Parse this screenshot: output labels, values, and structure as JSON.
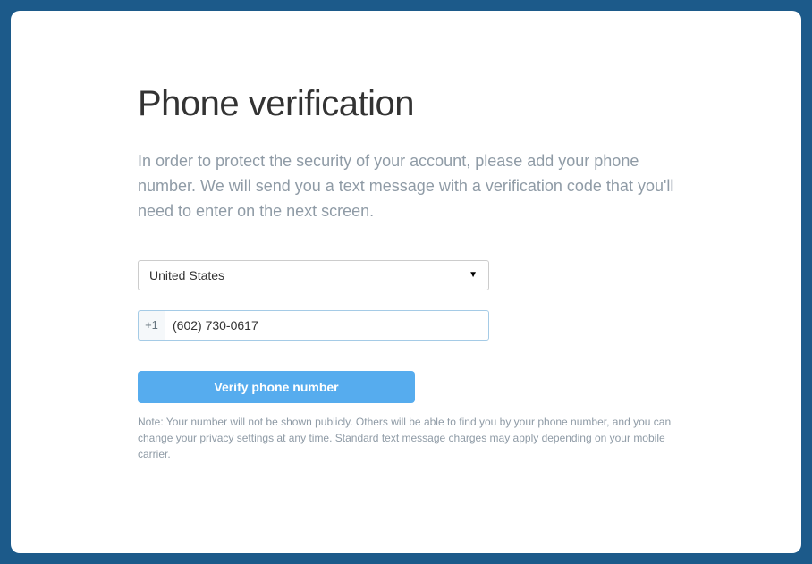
{
  "title": "Phone verification",
  "description": "In order to protect the security of your account, please add your phone number. We will send you a text message with a verification code that you'll need to enter on the next screen.",
  "country": {
    "selected": "United States"
  },
  "phone": {
    "prefix": "+1",
    "value": "(602) 730-0617"
  },
  "verify_label": "Verify phone number",
  "note": "Note: Your number will not be shown publicly. Others will be able to find you by your phone number, and you can change your privacy settings at any time. Standard text message charges may apply depending on your mobile carrier."
}
